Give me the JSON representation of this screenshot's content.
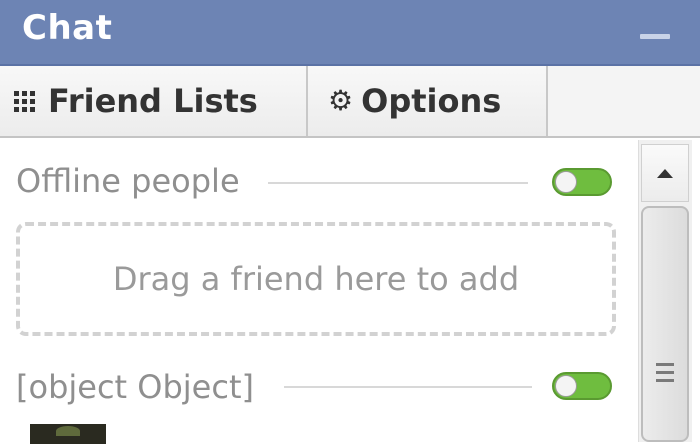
{
  "header": {
    "title": "Chat",
    "minimize_icon": "minimize-icon"
  },
  "tabs": {
    "friend_lists": {
      "label": "Friend Lists",
      "icon": "grid-icon"
    },
    "options": {
      "label": "Options",
      "icon": "gear-icon"
    }
  },
  "sections": [
    {
      "label": "Offline people",
      "toggle_on": true
    },
    {
      "label": "[object Object]",
      "toggle_on": true
    }
  ],
  "dropzone": {
    "text": "Drag a friend here to add"
  },
  "colors": {
    "header": "#6d84b4",
    "toggle_on": "#6fbd3f",
    "muted_text": "#8f8f8f"
  }
}
